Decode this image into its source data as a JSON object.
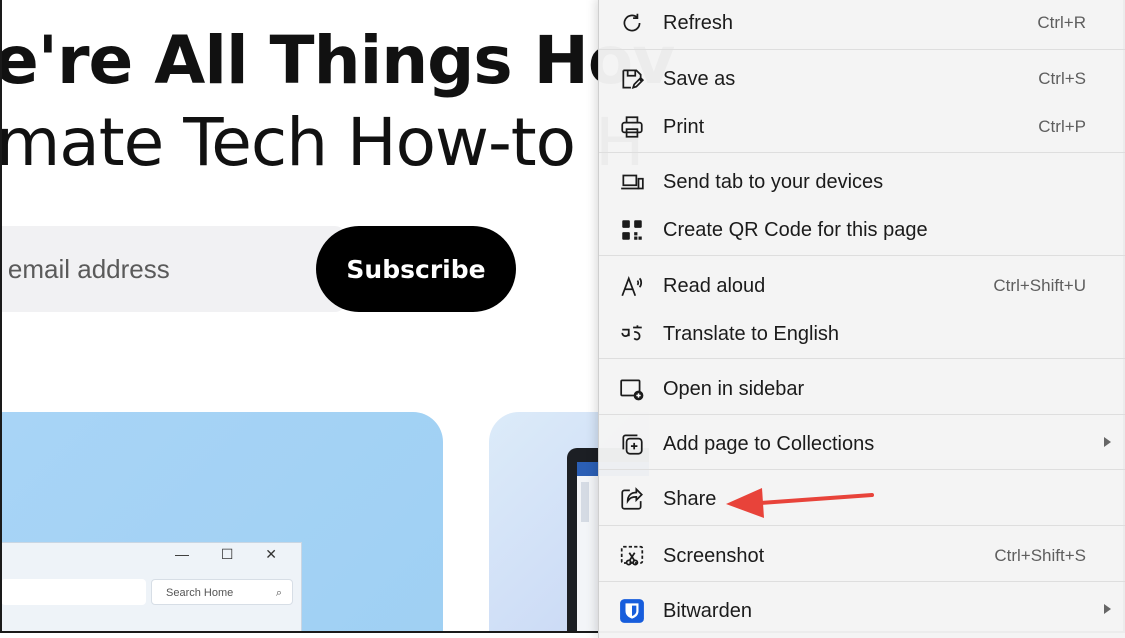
{
  "page": {
    "headline_line1": "e're All Things Hov",
    "headline_line2": "mate Tech How-to H",
    "email_placeholder": "r email address",
    "subscribe_label": "Subscribe",
    "card_search_text": "Search Home",
    "window_controls": "— ☐ ✕"
  },
  "context_menu": {
    "items": [
      {
        "label": "Refresh",
        "shortcut": "Ctrl+R",
        "icon": "refresh-icon"
      },
      {
        "label": "Save as",
        "shortcut": "Ctrl+S",
        "icon": "save-as-icon"
      },
      {
        "label": "Print",
        "shortcut": "Ctrl+P",
        "icon": "print-icon"
      },
      {
        "label": "Send tab to your devices",
        "shortcut": "",
        "icon": "send-tab-icon"
      },
      {
        "label": "Create QR Code for this page",
        "shortcut": "",
        "icon": "qr-code-icon"
      },
      {
        "label": "Read aloud",
        "shortcut": "Ctrl+Shift+U",
        "icon": "read-aloud-icon"
      },
      {
        "label": "Translate to English",
        "shortcut": "",
        "icon": "translate-icon"
      },
      {
        "label": "Open in sidebar",
        "shortcut": "",
        "icon": "open-sidebar-icon"
      },
      {
        "label": "Add page to Collections",
        "shortcut": "",
        "icon": "collections-icon",
        "submenu": true
      },
      {
        "label": "Share",
        "shortcut": "",
        "icon": "share-icon"
      },
      {
        "label": "Screenshot",
        "shortcut": "Ctrl+Shift+S",
        "icon": "screenshot-icon"
      },
      {
        "label": "Bitwarden",
        "shortcut": "",
        "icon": "bitwarden-icon",
        "submenu": true
      }
    ]
  },
  "colors": {
    "menu_bg": "#f4f4f4",
    "annotation_arrow": "#e8433a",
    "subscribe_bg": "#000000",
    "bitwarden_blue": "#175ddc"
  }
}
